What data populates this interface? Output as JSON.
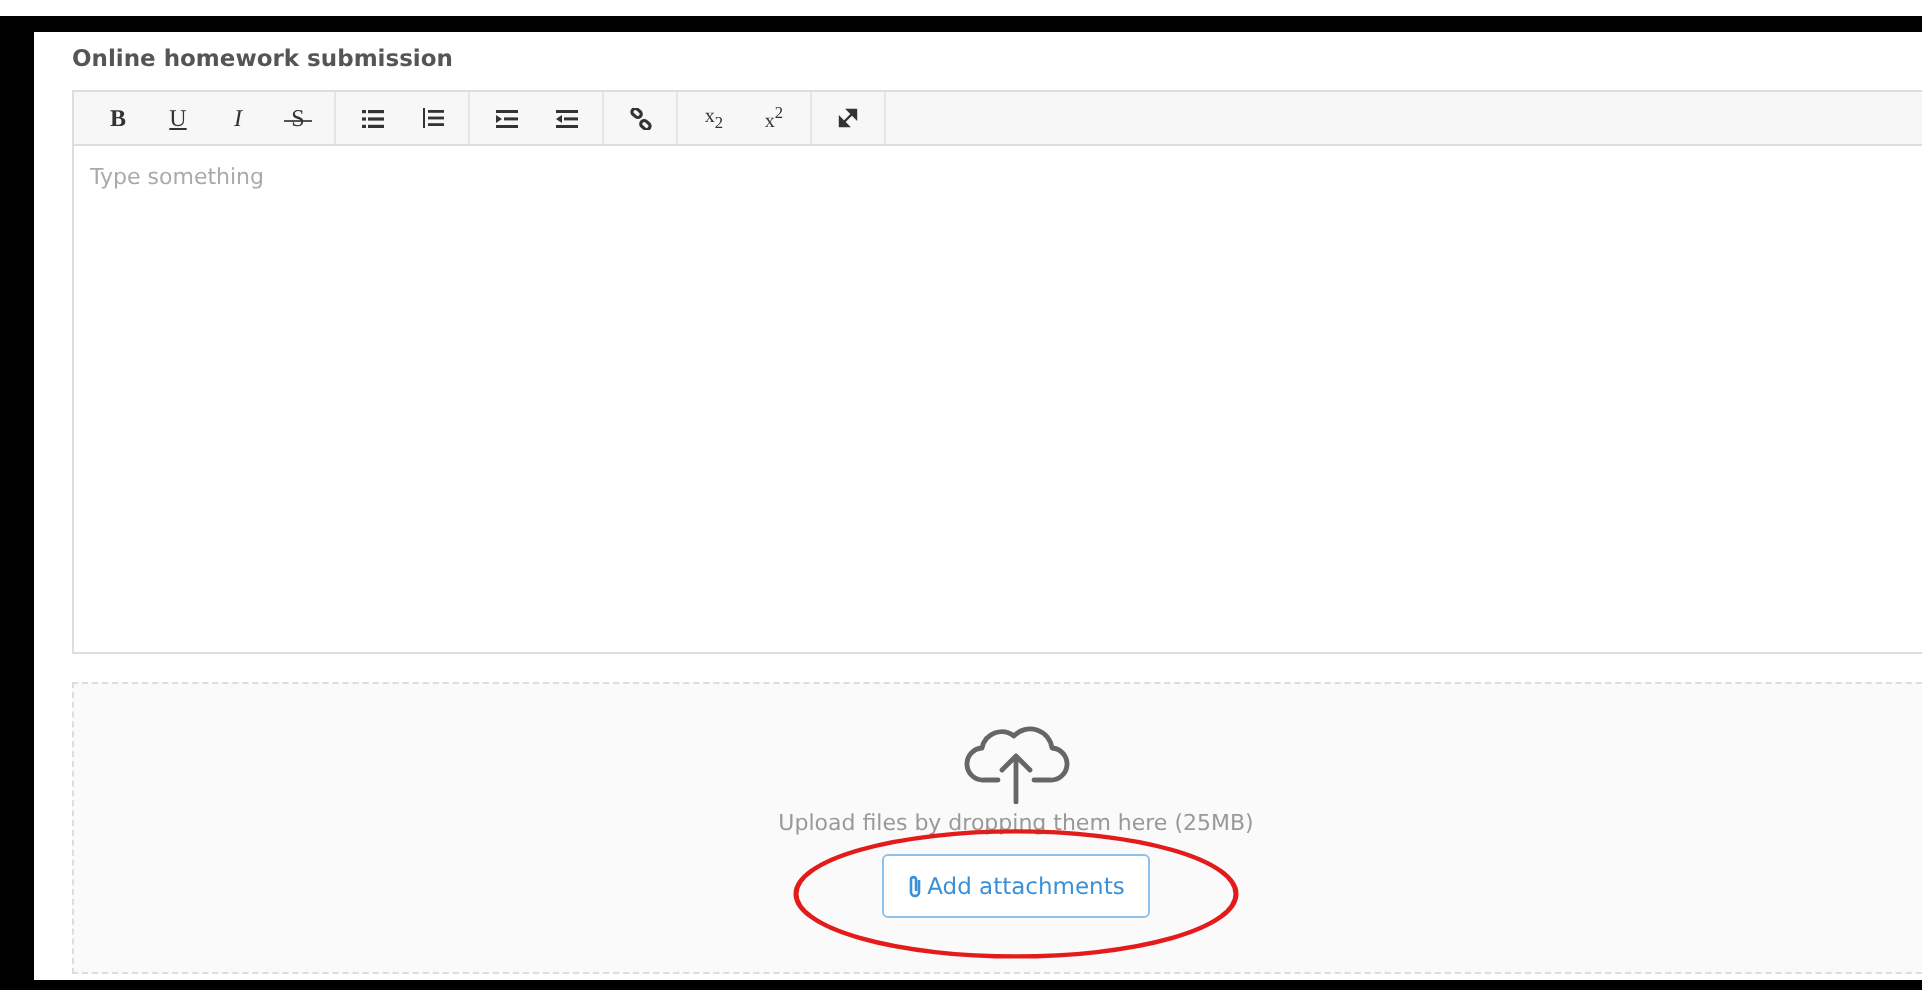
{
  "section_title": "Online homework submission",
  "toolbar": [
    [
      {
        "kind": "bold",
        "label": "B"
      },
      {
        "kind": "underline",
        "label": "U"
      },
      {
        "kind": "italic",
        "label": "I"
      },
      {
        "kind": "strike",
        "label": "S"
      }
    ],
    [
      {
        "kind": "bullet-list"
      },
      {
        "kind": "numbered-list"
      }
    ],
    [
      {
        "kind": "indent"
      },
      {
        "kind": "outdent"
      }
    ],
    [
      {
        "kind": "link"
      }
    ],
    [
      {
        "kind": "sub",
        "label": "x$_{2}$"
      },
      {
        "kind": "sup",
        "label": "x$^{2}$"
      }
    ],
    [
      {
        "kind": "expand"
      }
    ]
  ],
  "editor": {
    "placeholder": "Type something"
  },
  "upload": {
    "hint": "Upload files by dropping them here (25MB)",
    "button": "Add attachments"
  }
}
